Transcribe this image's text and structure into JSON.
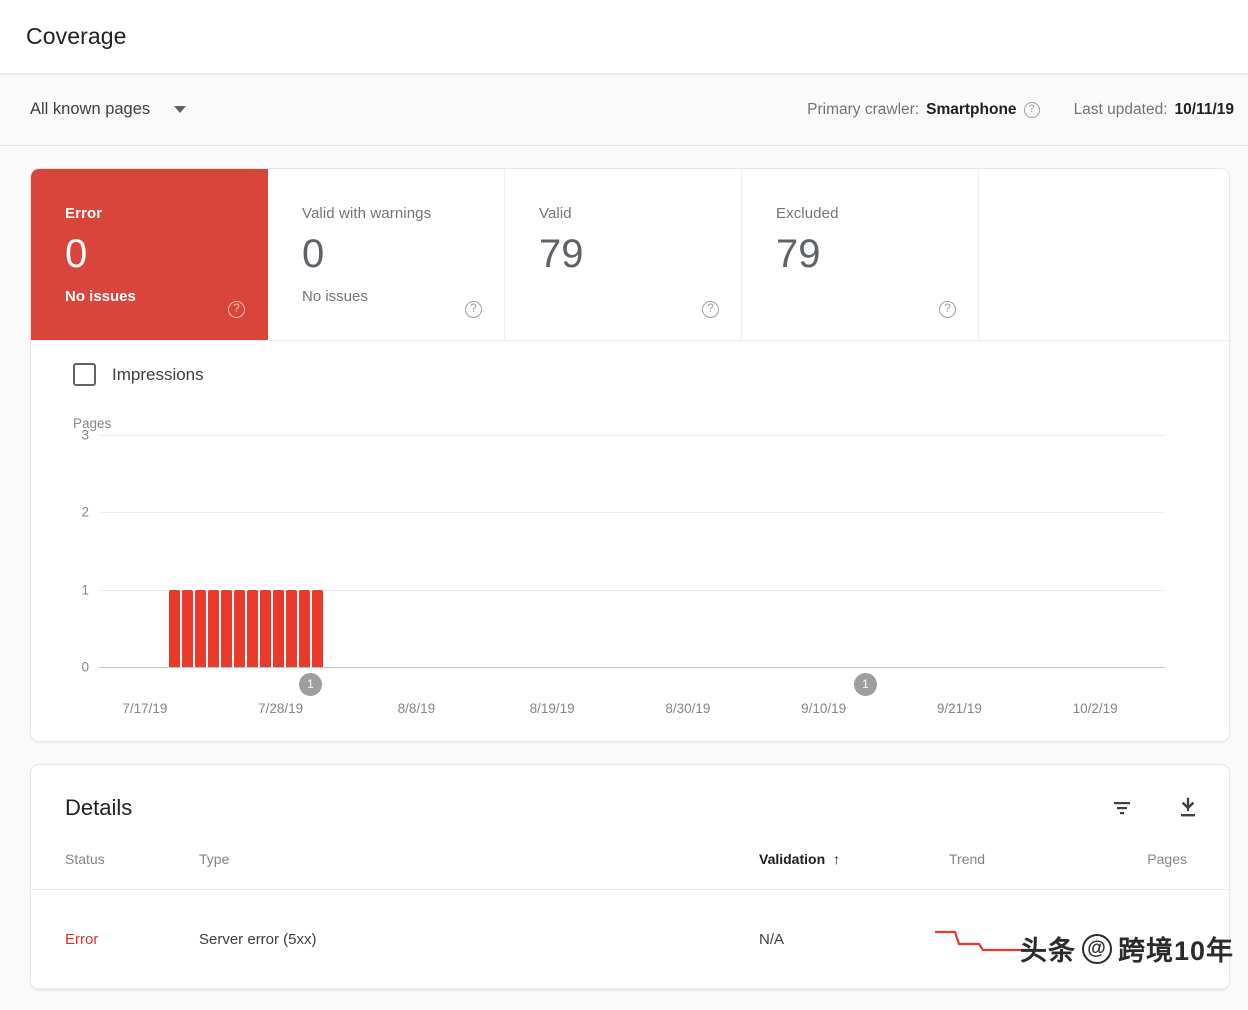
{
  "header": {
    "title": "Coverage"
  },
  "toolbar": {
    "page_filter": "All known pages",
    "caret_icon": "chevron-down-icon",
    "crawler_label": "Primary crawler:",
    "crawler_value": "Smartphone",
    "crawler_help_icon": "help-circle-icon",
    "last_updated_label": "Last updated:",
    "last_updated_value": "10/11/19"
  },
  "summary": {
    "cards": [
      {
        "label": "Error",
        "value": "0",
        "sub": "No issues",
        "selected": true,
        "help_icon": "help-circle-icon"
      },
      {
        "label": "Valid with warnings",
        "value": "0",
        "sub": "No issues",
        "selected": false,
        "help_icon": "help-circle-icon"
      },
      {
        "label": "Valid",
        "value": "79",
        "sub": "",
        "selected": false,
        "help_icon": "help-circle-icon"
      },
      {
        "label": "Excluded",
        "value": "79",
        "sub": "",
        "selected": false,
        "help_icon": "help-circle-icon"
      }
    ]
  },
  "chart_panel": {
    "impressions_label": "Impressions",
    "impressions_checked": false
  },
  "chart_data": {
    "type": "bar",
    "title": "",
    "xlabel": "",
    "ylabel": "Pages",
    "ylim": [
      0,
      3
    ],
    "yticks": [
      "0",
      "1",
      "2",
      "3"
    ],
    "grid": true,
    "legend": [
      "Impressions"
    ],
    "xticks": [
      "7/17/19",
      "7/28/19",
      "8/8/19",
      "8/19/19",
      "8/30/19",
      "9/10/19",
      "9/21/19",
      "10/2/19"
    ],
    "categories": [
      "7/20/19",
      "7/21/19",
      "7/22/19",
      "7/23/19",
      "7/24/19",
      "7/25/19",
      "7/26/19",
      "7/27/19",
      "7/28/19",
      "7/29/19",
      "7/30/19",
      "7/31/19"
    ],
    "values": [
      1,
      1,
      1,
      1,
      1,
      1,
      1,
      1,
      1,
      1,
      1,
      1
    ],
    "series_color": "#e8392b",
    "annotations": [
      {
        "label": "1",
        "x_near": "8/6/19"
      },
      {
        "label": "1",
        "x_near": "9/13/19"
      }
    ]
  },
  "details": {
    "title": "Details",
    "filter_icon": "filter-icon",
    "download_icon": "download-icon",
    "columns": [
      {
        "key": "status",
        "label": "Status",
        "sorted": false
      },
      {
        "key": "type",
        "label": "Type",
        "sorted": false
      },
      {
        "key": "validation",
        "label": "Validation",
        "sorted": true,
        "sort_icon": "arrow-up-icon"
      },
      {
        "key": "trend",
        "label": "Trend",
        "sorted": false
      },
      {
        "key": "pages",
        "label": "Pages",
        "sorted": false
      }
    ],
    "rows": [
      {
        "status": "Error",
        "type": "Server error (5xx)",
        "validation": "N/A",
        "trend": "declining",
        "pages": ""
      }
    ]
  },
  "watermark": {
    "logo_text": "头条",
    "at_symbol": "@",
    "handle": "跨境10年"
  },
  "colors": {
    "error_red": "#d9453a",
    "bar_red": "#e8392b",
    "status_error_text": "#d93025",
    "annotation_gray": "#9e9e9e"
  }
}
